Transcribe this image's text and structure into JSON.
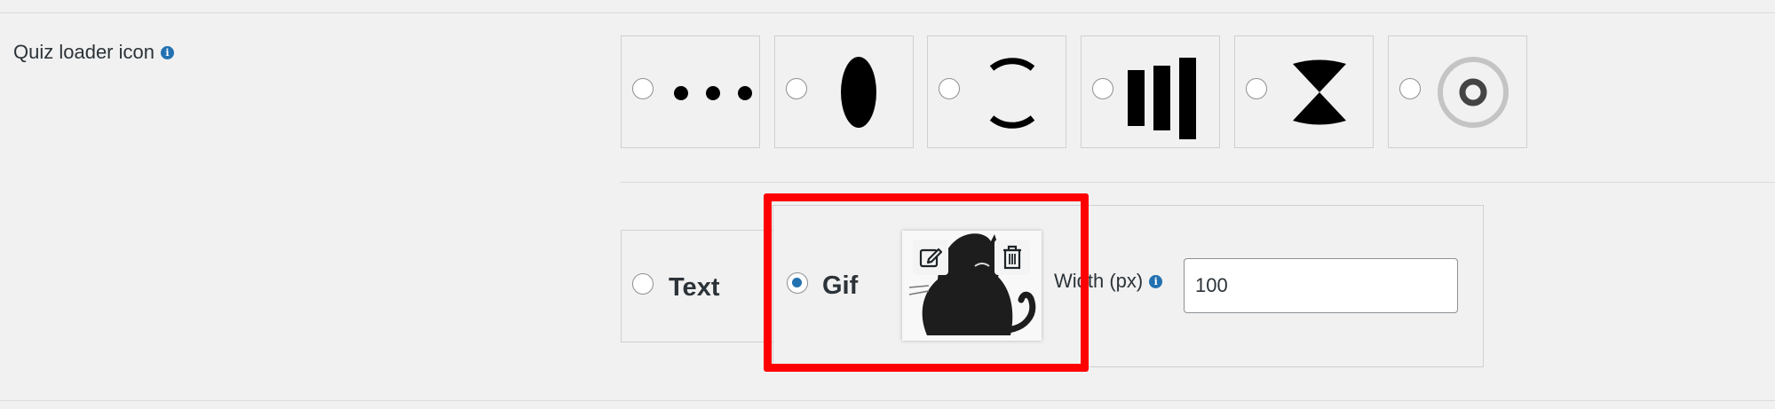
{
  "setting": {
    "label": "Quiz loader icon",
    "info_icon": "info-icon"
  },
  "loader_icons": [
    {
      "name": "dots",
      "selected": false
    },
    {
      "name": "ellipse",
      "selected": false
    },
    {
      "name": "arc-spinner",
      "selected": false
    },
    {
      "name": "bars",
      "selected": false
    },
    {
      "name": "hourglass",
      "selected": false
    },
    {
      "name": "ring",
      "selected": false
    }
  ],
  "loader_type": {
    "text_label": "Text",
    "gif_label": "Gif",
    "selected": "Gif"
  },
  "gif_thumbnail": {
    "edit_icon": "edit-icon",
    "delete_icon": "trash-icon",
    "image": "black-cat"
  },
  "width_field": {
    "label": "Width (px)",
    "value": "100"
  },
  "colors": {
    "accent": "#2271b1",
    "highlight": "#ff0000",
    "background": "#f1f1f1"
  }
}
